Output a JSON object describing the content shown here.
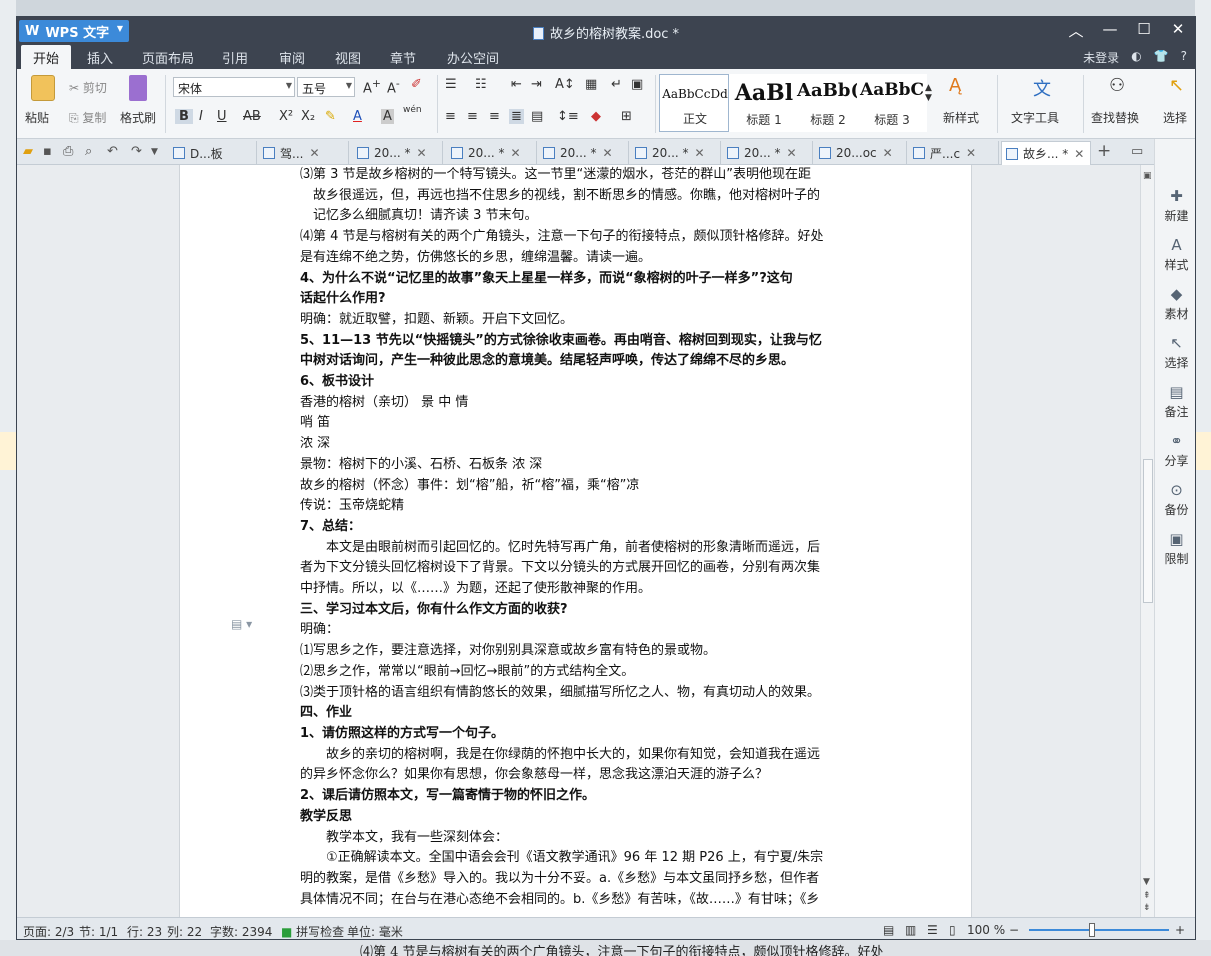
{
  "window": {
    "app_name": "WPS 文字",
    "app_logo": "W",
    "doc_title": "故乡的榕树教案.doc *",
    "controls": [
      "︿",
      "—",
      "☐",
      "✕"
    ]
  },
  "menu": {
    "items": [
      "开始",
      "插入",
      "页面布局",
      "引用",
      "审阅",
      "视图",
      "章节",
      "办公空间"
    ],
    "login": "未登录",
    "right_icons": [
      "◐",
      "👕",
      "?"
    ]
  },
  "ribbon": {
    "paste": "粘贴",
    "cut": "剪切",
    "copy": "复制",
    "format_painter": "格式刷",
    "font_name": "宋体",
    "font_size": "五号",
    "bold": "B",
    "italic": "I",
    "underline": "U",
    "strike": "AB",
    "superscript": "X²",
    "subscript": "X₂",
    "font_color": "A",
    "char_shading": "A",
    "pinyin": "wén",
    "styles": [
      {
        "preview": "AaBbCcDd",
        "label": "正文"
      },
      {
        "preview": "AaBl",
        "label": "标题 1"
      },
      {
        "preview": "AaBb(",
        "label": "标题 2"
      },
      {
        "preview": "AaBbC",
        "label": "标题 3"
      }
    ],
    "new_style": "新样式",
    "text_tools": "文字工具",
    "find_replace": "查找替换",
    "select": "选择"
  },
  "tabs": [
    {
      "label": "D...板",
      "active": false
    },
    {
      "label": "驾...",
      "active": false
    },
    {
      "label": "20... *",
      "active": false
    },
    {
      "label": "20... *",
      "active": false
    },
    {
      "label": "20... *",
      "active": false
    },
    {
      "label": "20... *",
      "active": false
    },
    {
      "label": "20... *",
      "active": false
    },
    {
      "label": "20...oc",
      "active": false
    },
    {
      "label": "严...c",
      "active": false
    },
    {
      "label": "故乡... *",
      "active": true
    }
  ],
  "tab_new": "+",
  "document": {
    "lines": [
      {
        "text": "⑶第 3 节是故乡榕树的一个特写镜头。这一节里“迷濛的烟水，苍茫的群山”表明他现在距",
        "style": ""
      },
      {
        "text": "故乡很遥远，但，再远也挡不住思乡的视线，割不断思乡的情感。你瞧，他对榕树叶子的",
        "style": "in2"
      },
      {
        "text": "记忆多么细腻真切！请齐读 3 节末句。",
        "style": "in2"
      },
      {
        "text": "⑷第 4 节是与榕树有关的两个广角镜头，注意一下句子的衔接特点，颇似顶针格修辞。好处",
        "style": ""
      },
      {
        "text": "是有连绵不绝之势，仿佛悠长的乡思，缠绵温馨。请读一遍。",
        "style": ""
      },
      {
        "text": "4、为什么不说“记忆里的故事”象天上星星一样多，而说“象榕树的叶子一样多”?这句",
        "style": "b"
      },
      {
        "text": "话起什么作用?",
        "style": "b"
      },
      {
        "text": "明确：就近取譬，扣题、新颖。开启下文回忆。",
        "style": ""
      },
      {
        "text": "5、11—13 节先以“快摇镜头”的方式徐徐收束画卷。再由哨音、榕树回到现实，让我与忆",
        "style": "b"
      },
      {
        "text": "中树对话询问，产生一种彼此思念的意境美。结尾轻声呼唤，传达了绵绵不尽的乡思。",
        "style": "b"
      },
      {
        "text": "6、板书设计",
        "style": "b"
      },
      {
        "text": "香港的榕树（亲切）                         景  中  情",
        "style": ""
      },
      {
        "text": "哨  笛",
        "style": ""
      },
      {
        "text": "浓 深",
        "style": ""
      },
      {
        "text": "景物：榕树下的小溪、石桥、石板条                浓 深",
        "style": ""
      },
      {
        "text": "故乡的榕树（怀念）事件：划“榕”船，祈“榕”福，乘“榕”凉",
        "style": ""
      },
      {
        "text": "传说：玉帝烧蛇精",
        "style": ""
      },
      {
        "text": "7、总结：",
        "style": "b"
      },
      {
        "text": "本文是由眼前树而引起回忆的。忆时先特写再广角，前者使榕树的形象清晰而遥远，后",
        "style": "in"
      },
      {
        "text": "者为下文分镜头回忆榕树设下了背景。下文以分镜头的方式展开回忆的画卷，分别有两次集",
        "style": ""
      },
      {
        "text": "中抒情。所以，以《……》为题，还起了使形散神聚的作用。",
        "style": ""
      },
      {
        "text": "三、学习过本文后，你有什么作文方面的收获?",
        "style": "b"
      },
      {
        "text": "明确：",
        "style": ""
      },
      {
        "text": "⑴写思乡之作，要注意选择，对你别别具深意或故乡富有特色的景或物。",
        "style": ""
      },
      {
        "text": "⑵思乡之作，常常以“眼前→回忆→眼前”的方式结构全文。",
        "style": ""
      },
      {
        "text": "⑶类于顶针格的语言组织有情韵悠长的效果，细腻描写所忆之人、物，有真切动人的效果。",
        "style": ""
      },
      {
        "text": "四、作业",
        "style": "b"
      },
      {
        "text": "1、请仿照这样的方式写一个句子。",
        "style": "b"
      },
      {
        "text": "故乡的亲切的榕树啊，我是在你绿荫的怀抱中长大的，如果你有知觉，会知道我在遥远",
        "style": "in"
      },
      {
        "text": "的异乡怀念你么？如果你有思想，你会象慈母一样，思念我这漂泊天涯的游子么？",
        "style": ""
      },
      {
        "text": "2、课后请仿照本文，写一篇寄情于物的怀旧之作。",
        "style": "b"
      },
      {
        "text": "教学反思",
        "style": "b"
      },
      {
        "text": "教学本文，我有一些深刻体会：",
        "style": "in"
      },
      {
        "text": "①正确解读本文。全国中语会会刊《语文教学通讯》96 年 12 期 P26 上，有宁夏/朱宗",
        "style": "in"
      },
      {
        "text": "明的教案，是借《乡愁》导入的。我以为十分不妥。a.《乡愁》与本文虽同抒乡愁，但作者",
        "style": ""
      },
      {
        "text": "具体情况不同；在台与在港心态绝不会相同的。b.《乡愁》有苦味，《故……》有甘味；《乡",
        "style": ""
      }
    ]
  },
  "sidepanel": [
    {
      "icon": "✚",
      "label": "新建"
    },
    {
      "icon": "A",
      "label": "样式"
    },
    {
      "icon": "◆",
      "label": "素材"
    },
    {
      "icon": "↖",
      "label": "选择"
    },
    {
      "icon": "▤",
      "label": "备注"
    },
    {
      "icon": "⚭",
      "label": "分享"
    },
    {
      "icon": "⊙",
      "label": "备份"
    },
    {
      "icon": "▣",
      "label": "限制"
    }
  ],
  "status": {
    "page": "页面: 2/3",
    "section": "节: 1/1",
    "row": "行: 23",
    "col": "列: 22",
    "words": "字数: 2394",
    "spell": "拼写检查",
    "unit": "单位: 毫米",
    "zoom": "100 %",
    "zoom_level": 0.45
  },
  "background": {
    "bottom_text": "⑷第 4 节是与榕树有关的两个广角镜头，注意一下句子的衔接特点，颇似顶针格修辞。好处"
  },
  "colors": {
    "titlebar": "#3d4450",
    "accent": "#3c8ad9",
    "ribbon": "#f4f6f8"
  }
}
